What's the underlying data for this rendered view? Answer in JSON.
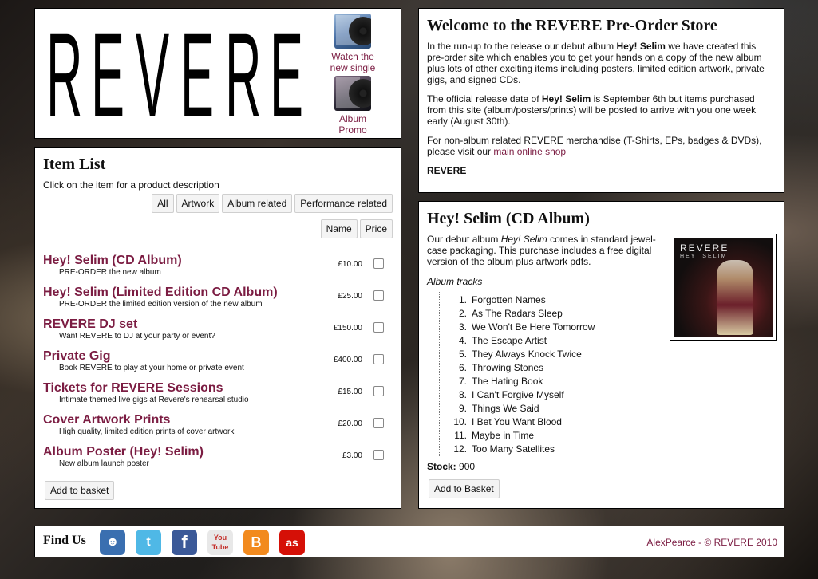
{
  "logo": {
    "letters": [
      "R",
      "E",
      "V",
      "E",
      "R",
      "E"
    ]
  },
  "side_links": [
    {
      "label_line1": "Watch the",
      "label_line2": "new single"
    },
    {
      "label_line1": "Album",
      "label_line2": "Promo"
    }
  ],
  "items_panel": {
    "title": "Item List",
    "hint": "Click on the item for a product description",
    "filters": [
      "All",
      "Artwork",
      "Album related",
      "Performance related"
    ],
    "sorts": [
      "Name",
      "Price"
    ],
    "items": [
      {
        "name": "Hey! Selim (CD Album)",
        "desc": "PRE-ORDER the new album",
        "price": "£10.00"
      },
      {
        "name": "Hey! Selim (Limited Edition CD Album)",
        "desc": "PRE-ORDER the limited edition version of the new album",
        "price": "£25.00"
      },
      {
        "name": "REVERE DJ set",
        "desc": "Want REVERE to DJ at your party or event?",
        "price": "£150.00"
      },
      {
        "name": "Private Gig",
        "desc": "Book REVERE to play at your home or private event",
        "price": "£400.00"
      },
      {
        "name": "Tickets for REVERE Sessions",
        "desc": "Intimate themed live gigs at Revere's rehearsal studio",
        "price": "£15.00"
      },
      {
        "name": "Cover Artwork Prints",
        "desc": "High quality, limited edition prints of cover artwork",
        "price": "£20.00"
      },
      {
        "name": "Album Poster (Hey! Selim)",
        "desc": "New album launch poster",
        "price": "£3.00"
      }
    ],
    "add_button": "Add to basket"
  },
  "welcome": {
    "title": "Welcome to the REVERE Pre-Order Store",
    "p1_a": "In the run-up to the release our debut album ",
    "p1_bold": "Hey! Selim",
    "p1_b": " we have created this pre-order site which enables you to get your hands on a copy of the new album plus lots of other exciting items including posters, limited edition artwork, private gigs, and signed CDs.",
    "p2_a": "The official release date of ",
    "p2_bold": "Hey! Selim",
    "p2_b": " is September 6th but items purchased from this site (album/posters/prints) will be posted to arrive with you one week early (August 30th).",
    "p3_a": "For non-album related REVERE merchandise (T-Shirts, EPs, badges & DVDs), please visit our ",
    "p3_link": "main online shop",
    "signoff": "REVERE"
  },
  "album": {
    "title": "Hey! Selim (CD Album)",
    "desc_a": "Our debut album ",
    "desc_italic": "Hey! Selim",
    "desc_b": " comes in standard jewel-case packaging. This purchase includes a free digital version of the album plus artwork pdfs.",
    "tracks_label": "Album tracks",
    "tracks": [
      "Forgotten Names",
      "As The Radars Sleep",
      "We Won't Be Here Tomorrow",
      "The Escape Artist",
      "They Always Knock Twice",
      "Throwing Stones",
      "The Hating Book",
      "I Can't Forgive Myself",
      "Things We Said",
      "I Bet You Want Blood",
      "Maybe in Time",
      "Too Many Satellites"
    ],
    "stock_label": "Stock:",
    "stock_value": "900",
    "add_button": "Add to Basket",
    "cover_title": "REVERE",
    "cover_subtitle": "HEY! SELIM"
  },
  "footer": {
    "find_us": "Find Us",
    "social": [
      {
        "icon": "myspace-icon",
        "glyph": "☻",
        "color": "#3a6fb0"
      },
      {
        "icon": "twitter-icon",
        "glyph": "t",
        "color": "#4fb8e6"
      },
      {
        "icon": "facebook-icon",
        "glyph": "f",
        "color": "#3b5998"
      },
      {
        "icon": "youtube-icon",
        "glyph": "You Tube",
        "color": "#d9d9d9"
      },
      {
        "icon": "blogger-icon",
        "glyph": "B",
        "color": "#f28a1e"
      },
      {
        "icon": "lastfm-icon",
        "glyph": "as",
        "color": "#d51007"
      }
    ],
    "credit_author": "AlexPearce",
    "credit_rest": " - © REVERE 2010"
  }
}
